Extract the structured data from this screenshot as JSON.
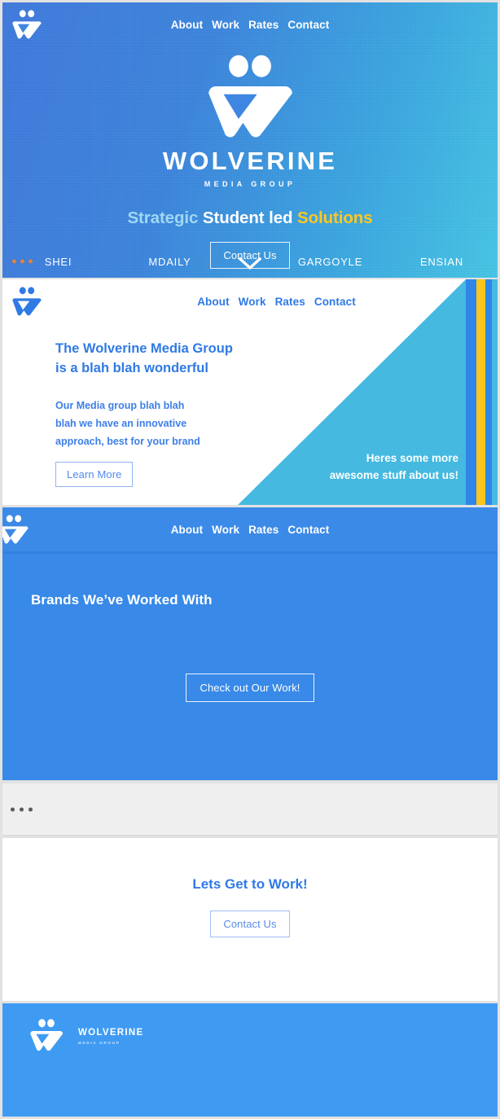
{
  "brand": {
    "name": "WOLVERINE",
    "subtitle": "MEDIA GROUP",
    "logo_icon": "wolverine-w-mark-icon"
  },
  "colors": {
    "primary_blue": "#3889e8",
    "light_blue": "#45b9e0",
    "accent_gold": "#fbc51c",
    "link_blue": "#2f7ae5",
    "tagline_light": "#9fd8f2",
    "footer_blue": "#3f9bf2",
    "grey_band": "#efefef"
  },
  "nav": {
    "items": [
      {
        "label": "About"
      },
      {
        "label": "Work"
      },
      {
        "label": "Rates"
      },
      {
        "label": "Contact"
      }
    ]
  },
  "hero": {
    "tagline": {
      "part1": "Strategic",
      "part2": "Student led",
      "part3": "Solutions"
    },
    "cta_label": "Contact Us",
    "chevron_icon": "chevron-down-icon",
    "ellipsis_icon": "ellipsis-icon",
    "brands": [
      {
        "label": "SHEI"
      },
      {
        "label": "MDAILY"
      },
      {
        "label": "GARGOYLE"
      },
      {
        "label": "ENSIAN"
      }
    ]
  },
  "about_section": {
    "heading_line1": "The Wolverine Media Group",
    "heading_line2": "is a blah blah wonderful",
    "body_line1": "Our Media group blah blah",
    "body_line2": "blah we have an innovative",
    "body_line3": "approach, best for your brand",
    "cta_label": "Learn More",
    "panel_line1": "Heres some more",
    "panel_line2": "awesome stuff about us!"
  },
  "brands_section": {
    "title": "Brands We’ve Worked With",
    "cta_label": "Check out Our Work!"
  },
  "divider_section": {
    "ellipsis_icon": "ellipsis-icon"
  },
  "contact_section": {
    "title": "Lets Get to Work!",
    "cta_label": "Contact Us"
  },
  "footer": {
    "wordmark": "WOLVERINE",
    "sub_wordmark": "MEDIA GROUP"
  }
}
